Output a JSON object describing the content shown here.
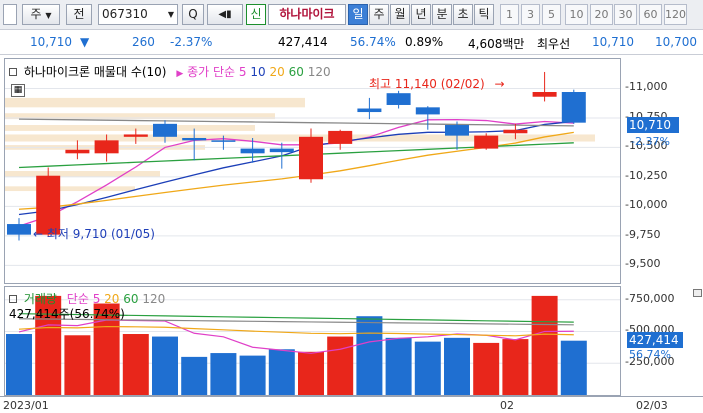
{
  "toolbar": {
    "period_label": "주",
    "prev_label": "전",
    "code": "067310",
    "search_label": "Q",
    "sound_label": "◀▮",
    "new_badge": "신",
    "stock_name": "하나마이크",
    "period_tabs": [
      "일",
      "주",
      "월",
      "년",
      "분",
      "초",
      "틱"
    ],
    "active_tab": "일",
    "interval_buttons": [
      "1",
      "3",
      "5",
      "10",
      "20",
      "30",
      "60",
      "120"
    ]
  },
  "infobar": {
    "price": "10,710",
    "change_arrow": "▼",
    "change": "260",
    "change_pct": "-2.37%",
    "volume": "427,414",
    "vol_ratio": "56.74%",
    "turnover": "0.89%",
    "amount": "4,608백만",
    "bid_label": "최우선",
    "bid": "10,710",
    "ask": "10,700"
  },
  "price_panel": {
    "title": "하나마이크론 매물대 수(10)",
    "ma_label": "종가 단순",
    "ma_periods": [
      "5",
      "10",
      "20",
      "60",
      "120"
    ],
    "high_annotation": "최고 11,140 (02/02)",
    "low_annotation": "최저 9,710 (01/05)",
    "y_ticks": [
      "11,000",
      "10,750",
      "10,500",
      "10,250",
      "10,000",
      "9,750",
      "9,500"
    ],
    "current_price_tag": "10,710",
    "current_change_tag": "-2.37%"
  },
  "volume_panel": {
    "title": "거래량",
    "ma_label": "단순",
    "ma_periods": [
      "5",
      "20",
      "60",
      "120"
    ],
    "volume_annotation": "427,414주(56.74%)",
    "y_ticks": [
      "750,000",
      "500,000",
      "250,000"
    ],
    "current_volume_tag": "427,414",
    "current_pct_tag": "56.74%"
  },
  "x_axis": {
    "labels": [
      "2023/01",
      "02",
      "02/03"
    ]
  },
  "colors": {
    "up": "#e8261b",
    "down": "#1f6fd1",
    "ma5": "#e040c8",
    "ma10": "#1c3fb8",
    "ma20": "#f0a818",
    "ma60": "#2aa040",
    "ma120": "#888888",
    "vol_profile": "#f7e7cf"
  },
  "chart_data": {
    "type": "candlestick",
    "candles": [
      {
        "o": 9850,
        "h": 9900,
        "l": 9710,
        "c": 9760
      },
      {
        "o": 9760,
        "h": 10330,
        "l": 9740,
        "c": 10260
      },
      {
        "o": 10450,
        "h": 10560,
        "l": 10400,
        "c": 10480
      },
      {
        "o": 10450,
        "h": 10610,
        "l": 10380,
        "c": 10560
      },
      {
        "o": 10590,
        "h": 10660,
        "l": 10530,
        "c": 10610
      },
      {
        "o": 10700,
        "h": 10730,
        "l": 10540,
        "c": 10590
      },
      {
        "o": 10580,
        "h": 10660,
        "l": 10390,
        "c": 10560
      },
      {
        "o": 10560,
        "h": 10600,
        "l": 10480,
        "c": 10550
      },
      {
        "o": 10490,
        "h": 10580,
        "l": 10370,
        "c": 10450
      },
      {
        "o": 10490,
        "h": 10540,
        "l": 10320,
        "c": 10460
      },
      {
        "o": 10230,
        "h": 10660,
        "l": 10200,
        "c": 10590
      },
      {
        "o": 10530,
        "h": 10650,
        "l": 10480,
        "c": 10640
      },
      {
        "o": 10830,
        "h": 10920,
        "l": 10740,
        "c": 10800
      },
      {
        "o": 10960,
        "h": 10980,
        "l": 10830,
        "c": 10860
      },
      {
        "o": 10840,
        "h": 10850,
        "l": 10650,
        "c": 10780
      },
      {
        "o": 10690,
        "h": 10720,
        "l": 10480,
        "c": 10600
      },
      {
        "o": 10490,
        "h": 10620,
        "l": 10480,
        "c": 10600
      },
      {
        "o": 10620,
        "h": 10700,
        "l": 10570,
        "c": 10650
      },
      {
        "o": 10930,
        "h": 11140,
        "l": 10890,
        "c": 10970
      },
      {
        "o": 10970,
        "h": 10990,
        "l": 10700,
        "c": 10710
      }
    ],
    "volumes": [
      480000,
      780000,
      470000,
      720000,
      480000,
      460000,
      300000,
      330000,
      310000,
      360000,
      340000,
      460000,
      620000,
      450000,
      420000,
      450000,
      410000,
      440000,
      780000,
      427414
    ],
    "ylim": [
      9350,
      11250
    ],
    "volume_ylim": [
      0,
      850000
    ]
  }
}
